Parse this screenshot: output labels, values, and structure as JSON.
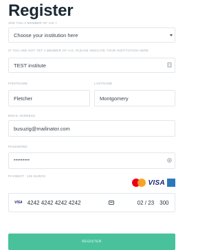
{
  "page": {
    "title": "Register"
  },
  "member_question": {
    "label": "ARE YOU A MEMBER OF IAS ?",
    "selected": "Choose your institution here"
  },
  "institution": {
    "label": "IF YOU ARE NOT YET A MEMBER OF IAS, PLEASE INDICATE YOUR INSTITUTION HERE",
    "value": "TEST institute"
  },
  "firstname": {
    "label": "FIRSTNAME",
    "value": "Fletcher"
  },
  "lastname": {
    "label": "LASTNAME",
    "value": "Montgomery"
  },
  "email": {
    "label": "EMAIL ADDRESS",
    "value": "busuzig@mailinator.com"
  },
  "password": {
    "label": "PASSWORD",
    "value": "•••••••••"
  },
  "payment": {
    "label": "PAYMENT : 100 EUROS",
    "card_brands": [
      "mastercard",
      "VISA",
      "amex"
    ],
    "card_brand_small": "VISA",
    "card_number": "4242 4242 4242 4242",
    "expiry": "02 / 23",
    "cvc": "300"
  },
  "actions": {
    "register_label": "REGISTER"
  },
  "colors": {
    "accent": "#49c19b",
    "heading": "#1d2a36",
    "label": "#a3acb5",
    "border": "#e2e6ea"
  },
  "icons": {
    "institution_field": "building-icon",
    "password_field": "eye-icon",
    "cvc_field": "card-cvc-icon",
    "select": "chevron-down-icon"
  }
}
